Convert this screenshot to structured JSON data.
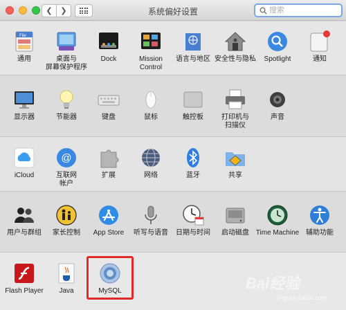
{
  "window": {
    "title": "系统偏好设置"
  },
  "search": {
    "placeholder": "搜索"
  },
  "rows": [
    [
      {
        "id": "general",
        "label": "通用",
        "icon": "general-file-icon"
      },
      {
        "id": "desktop",
        "label": "桌面与\n屏幕保护程序",
        "icon": "desktop-icon"
      },
      {
        "id": "dock",
        "label": "Dock",
        "icon": "dock-icon"
      },
      {
        "id": "mission",
        "label": "Mission\nControl",
        "icon": "mission-control-icon"
      },
      {
        "id": "language",
        "label": "语言与地区",
        "icon": "globe-flag-icon"
      },
      {
        "id": "security",
        "label": "安全性与隐私",
        "icon": "house-icon"
      },
      {
        "id": "spotlight",
        "label": "Spotlight",
        "icon": "spotlight-icon"
      },
      {
        "id": "notifications",
        "label": "通知",
        "icon": "notifications-icon"
      }
    ],
    [
      {
        "id": "displays",
        "label": "显示器",
        "icon": "display-icon"
      },
      {
        "id": "energy",
        "label": "节能器",
        "icon": "lightbulb-icon"
      },
      {
        "id": "keyboard",
        "label": "键盘",
        "icon": "keyboard-icon"
      },
      {
        "id": "mouse",
        "label": "鼠标",
        "icon": "mouse-icon"
      },
      {
        "id": "trackpad",
        "label": "触控板",
        "icon": "trackpad-icon"
      },
      {
        "id": "printers",
        "label": "打印机与\n扫描仪",
        "icon": "printer-icon"
      },
      {
        "id": "sound",
        "label": "声音",
        "icon": "speaker-icon"
      }
    ],
    [
      {
        "id": "icloud",
        "label": "iCloud",
        "icon": "icloud-icon"
      },
      {
        "id": "internet",
        "label": "互联网\n帐户",
        "icon": "at-sign-icon"
      },
      {
        "id": "extensions",
        "label": "扩展",
        "icon": "puzzle-icon"
      },
      {
        "id": "network",
        "label": "网络",
        "icon": "network-globe-icon"
      },
      {
        "id": "bluetooth",
        "label": "蓝牙",
        "icon": "bluetooth-icon"
      },
      {
        "id": "sharing",
        "label": "共享",
        "icon": "sharing-folder-icon"
      }
    ],
    [
      {
        "id": "users",
        "label": "用户与群组",
        "icon": "users-icon"
      },
      {
        "id": "parental",
        "label": "家长控制",
        "icon": "parental-controls-icon"
      },
      {
        "id": "appstore",
        "label": "App Store",
        "icon": "app-store-icon"
      },
      {
        "id": "dictation",
        "label": "听写与语音",
        "icon": "microphone-icon"
      },
      {
        "id": "datetime",
        "label": "日期与时间",
        "icon": "clock-calendar-icon"
      },
      {
        "id": "startup",
        "label": "启动磁盘",
        "icon": "hard-disk-icon"
      },
      {
        "id": "timemachine",
        "label": "Time Machine",
        "icon": "time-machine-icon"
      },
      {
        "id": "accessibility",
        "label": "辅助功能",
        "icon": "accessibility-icon"
      }
    ],
    [
      {
        "id": "flash",
        "label": "Flash Player",
        "icon": "flash-player-icon"
      },
      {
        "id": "java",
        "label": "Java",
        "icon": "java-icon"
      },
      {
        "id": "mysql",
        "label": "MySQL",
        "icon": "mysql-icon"
      }
    ]
  ],
  "watermark": {
    "text": "Bai经验",
    "sub": "jingyan.baidu.com"
  }
}
